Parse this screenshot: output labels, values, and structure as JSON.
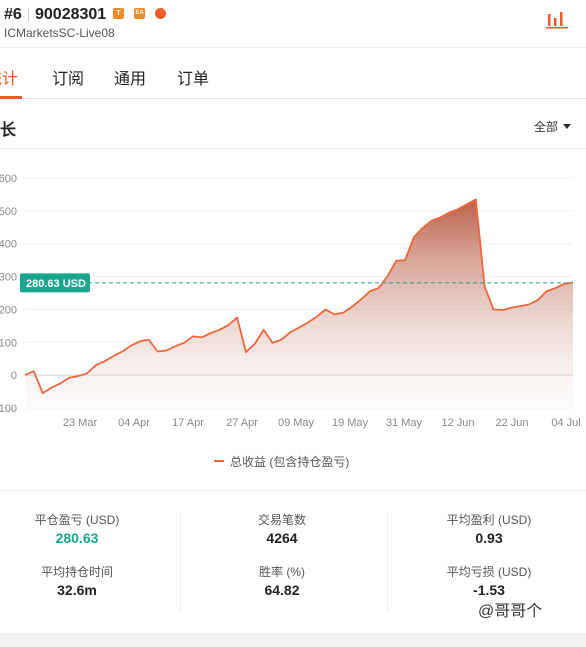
{
  "header": {
    "rank": "#6",
    "account": "90028301",
    "server": "ICMarketsSC-Live08",
    "badges": [
      {
        "name": "trader-badge-icon",
        "color": "#f08a24",
        "text": "T"
      },
      {
        "name": "ea-badge-icon",
        "color": "#f08a24",
        "text": "EA"
      },
      {
        "name": "fire-badge-icon",
        "color": "#f05a28",
        "text": ""
      }
    ]
  },
  "tabs": [
    "统计",
    "订阅",
    "通用",
    "订单"
  ],
  "section": {
    "title": "成长",
    "filter": "全部"
  },
  "chart_data": {
    "type": "area",
    "title": "成长",
    "legend": "总收益 (包含持仓盈亏)",
    "y_ticks": [
      "600",
      "500",
      "400",
      "300",
      "200",
      "100",
      "0",
      "-100"
    ],
    "x_ticks": [
      "23 Mar",
      "04 Apr",
      "17 Apr",
      "27 Apr",
      "09 May",
      "19 May",
      "31 May",
      "12 Jun",
      "22 Jun",
      "04 Jul"
    ],
    "ylim": [
      -100,
      600
    ],
    "current_label": "280.63 USD",
    "current_value": 280.63,
    "series": [
      {
        "values": [
          0,
          12,
          -55,
          -38,
          -25,
          -8,
          -3,
          5,
          30,
          42,
          58,
          72,
          90,
          103,
          108,
          72,
          75,
          88,
          98,
          118,
          115,
          128,
          138,
          152,
          175,
          70,
          95,
          138,
          98,
          108,
          130,
          145,
          160,
          178,
          200,
          185,
          190,
          208,
          230,
          255,
          265,
          300,
          348,
          350,
          420,
          448,
          470,
          480,
          495,
          505,
          520,
          535,
          270,
          200,
          198,
          205,
          210,
          215,
          228,
          255,
          265,
          278,
          282
        ]
      }
    ]
  },
  "stats": [
    {
      "label": "平仓盈亏 (USD)",
      "value": "280.63",
      "color": "green"
    },
    {
      "label": "交易笔数",
      "value": "4264",
      "color": ""
    },
    {
      "label": "平均盈利 (USD)",
      "value": "0.93",
      "color": ""
    },
    {
      "label": "平均持仓时间",
      "value": "32.6m",
      "color": ""
    },
    {
      "label": "胜率 (%)",
      "value": "64.82",
      "color": ""
    },
    {
      "label": "平均亏损 (USD)",
      "value": "-1.53",
      "color": ""
    }
  ],
  "watermark": "@哥哥个",
  "colors": {
    "accent": "#f05a28",
    "line": "#f0663b",
    "green": "#1aa58f"
  }
}
